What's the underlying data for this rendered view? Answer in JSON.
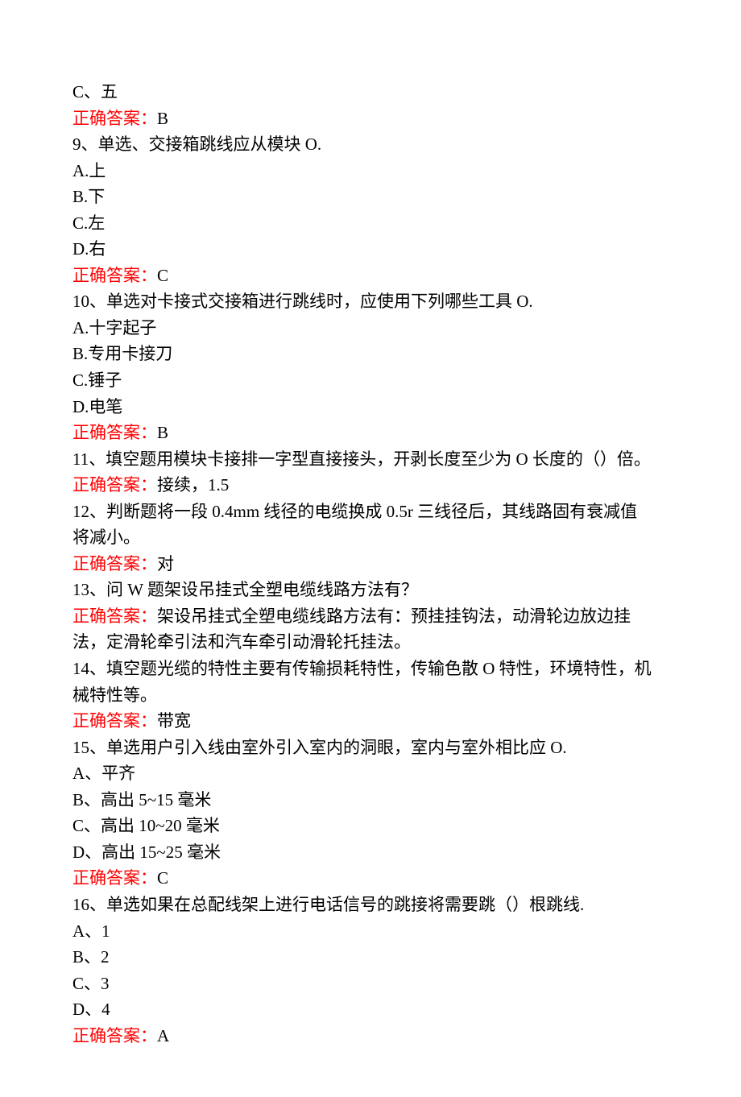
{
  "labels": {
    "correct_answer_prefix": "正确答案："
  },
  "lines": {
    "q8_optC": "C、五",
    "q8_ans": "B",
    "q9_stem": "9、单选、交接箱跳线应从模块 O.",
    "q9_A": "A.上",
    "q9_B": "B.下",
    "q9_C": "C.左",
    "q9_D": "D.右",
    "q9_ans": "C",
    "q10_stem": "10、单选对卡接式交接箱进行跳线时，应使用下列哪些工具 O.",
    "q10_A": "A.十字起子",
    "q10_B": "B.专用卡接刀",
    "q10_C": "C.锤子",
    "q10_D": "D.电笔",
    "q10_ans": "B",
    "q11_stem": "11、填空题用模块卡接排一字型直接接头，开剥长度至少为 O 长度的（）倍。",
    "q11_ans": "接续，1.5",
    "q12_stem_a": "12、判断题将一段 0.4mm 线径的电缆换成 0.5r 三线径后，其线路固有衰减值",
    "q12_stem_b": "将减小。",
    "q12_ans": "对",
    "q13_stem": "13、问 W 题架设吊挂式全塑电缆线路方法有？",
    "q13_ans_a": "架设吊挂式全塑电缆线路方法有：预挂挂钩法，动滑轮边放边挂",
    "q13_ans_b": "法，定滑轮牵引法和汽车牵引动滑轮托挂法。",
    "q14_stem_a": "14、填空题光缆的特性主要有传输损耗特性，传输色散 O 特性，环境特性，机",
    "q14_stem_b": "械特性等。",
    "q14_ans": "带宽",
    "q15_stem": "15、单选用户引入线由室外引入室内的洞眼，室内与室外相比应 O.",
    "q15_A": "A、平齐",
    "q15_B": "B、高出 5~15 毫米",
    "q15_C": "C、高出 10~20 毫米",
    "q15_D": "D、高出 15~25 毫米",
    "q15_ans": "C",
    "q16_stem": "16、单选如果在总配线架上进行电话信号的跳接将需要跳（）根跳线.",
    "q16_A": "A、1",
    "q16_B": "B、2",
    "q16_C": "C、3",
    "q16_D": "D、4",
    "q16_ans": "A"
  }
}
